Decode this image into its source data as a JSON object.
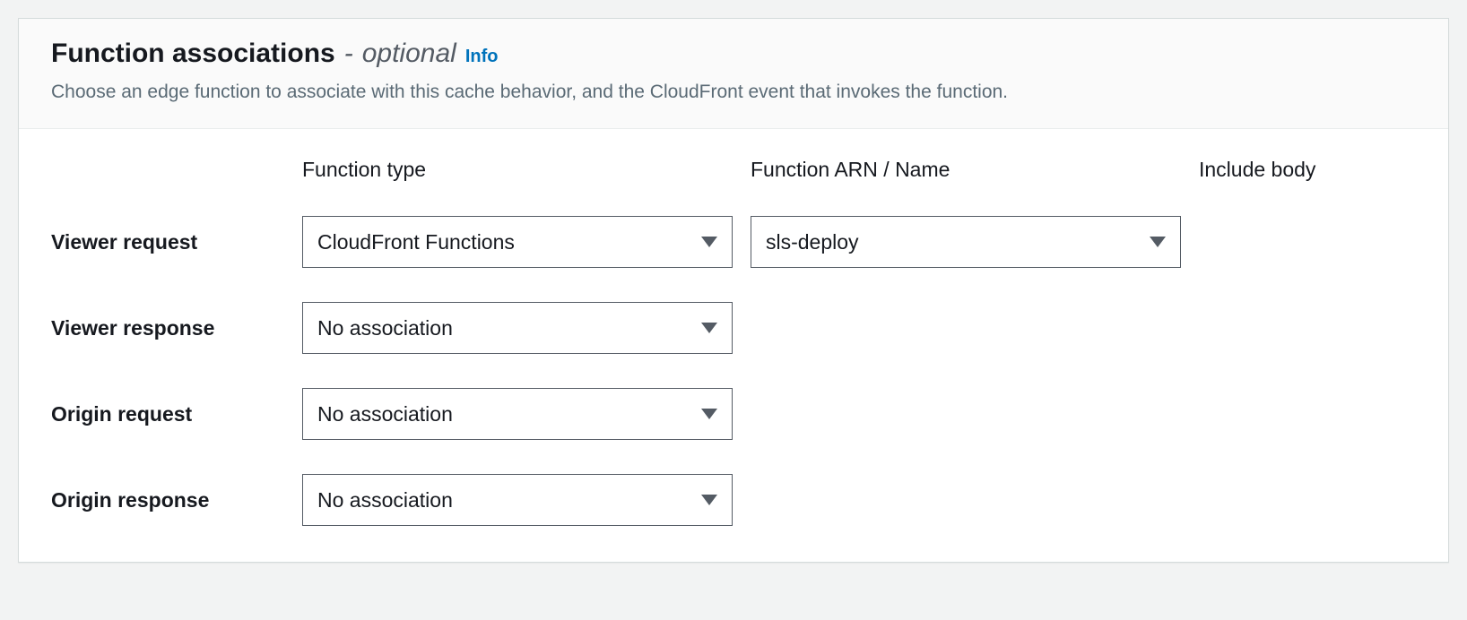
{
  "header": {
    "title": "Function associations",
    "separator": "-",
    "optional": "optional",
    "info": "Info",
    "subtitle": "Choose an edge function to associate with this cache behavior, and the CloudFront event that invokes the function."
  },
  "columns": {
    "type": "Function type",
    "arn": "Function ARN / Name",
    "body": "Include body"
  },
  "rows": [
    {
      "label": "Viewer request",
      "type": "CloudFront Functions",
      "arn": "sls-deploy"
    },
    {
      "label": "Viewer response",
      "type": "No association",
      "arn": ""
    },
    {
      "label": "Origin request",
      "type": "No association",
      "arn": ""
    },
    {
      "label": "Origin response",
      "type": "No association",
      "arn": ""
    }
  ]
}
